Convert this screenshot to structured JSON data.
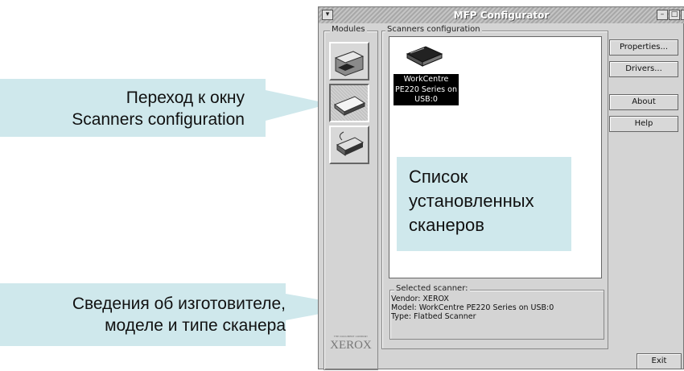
{
  "window": {
    "title": "MFP Configurator"
  },
  "modules": {
    "legend": "Modules"
  },
  "scanners": {
    "legend": "Scanners configuration",
    "item_label_lines": [
      "WorkCentre",
      "PE220 Series on",
      "USB:0"
    ]
  },
  "buttons": {
    "properties": "Properties...",
    "drivers": "Drivers...",
    "about": "About",
    "help": "Help",
    "exit": "Exit"
  },
  "selected_scanner": {
    "legend": "Selected scanner:",
    "vendor": "Vendor: XEROX",
    "model": "Model: WorkCentre PE220 Series on USB:0",
    "type": "Type: Flatbed Scanner"
  },
  "brand": {
    "logo": "XEROX",
    "tagline": "THE DOCUMENT COMPANY"
  },
  "callouts": {
    "scanners_window_lines": [
      "Переход к окну",
      "Scanners configuration"
    ],
    "installed_list_lines": [
      "Список",
      "установленных",
      "сканеров"
    ],
    "scanner_info_lines": [
      "Сведения об изготовителе,",
      "моделе и типе сканера"
    ]
  },
  "colors": {
    "callout_bg": "#cfe8ec",
    "window_bg": "#d4d4d4",
    "title_stripes": "#a8a8a8"
  }
}
